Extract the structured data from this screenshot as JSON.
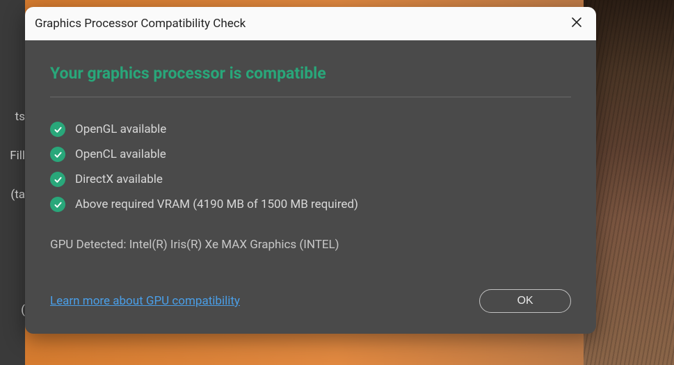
{
  "background": {
    "left_items": [
      "ts",
      "Fill",
      "ta)",
      "",
      ")"
    ]
  },
  "dialog": {
    "title": "Graphics Processor Compatibility Check",
    "heading": "Your graphics processor is compatible",
    "checks": [
      {
        "label": "OpenGL available",
        "status": "ok"
      },
      {
        "label": "OpenCL available",
        "status": "ok"
      },
      {
        "label": "DirectX available",
        "status": "ok"
      },
      {
        "label": "Above required VRAM (4190 MB of 1500 MB required)",
        "status": "ok"
      }
    ],
    "gpu_detected": "GPU Detected: Intel(R) Iris(R) Xe MAX Graphics (INTEL)",
    "learn_more": "Learn more about GPU compatibility",
    "ok_label": "OK",
    "colors": {
      "success": "#29a77a",
      "link": "#4a9fe8",
      "body_bg": "#4a4a4a",
      "titlebar_bg": "#fafafa"
    }
  }
}
